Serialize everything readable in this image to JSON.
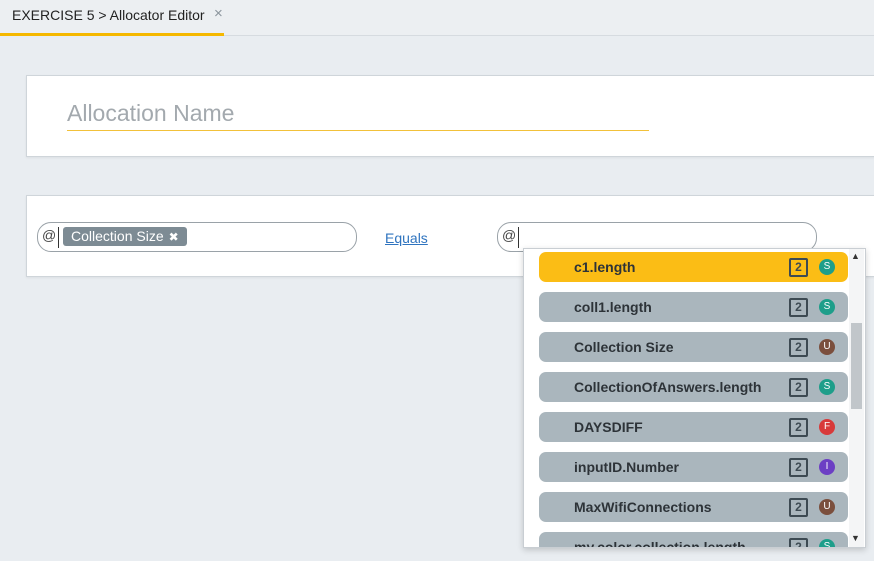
{
  "tab": {
    "title": "EXERCISE 5 > Allocator Editor",
    "close_icon": "×"
  },
  "allocation": {
    "name_value": "",
    "name_placeholder": "Allocation Name"
  },
  "rule": {
    "left_at": "@",
    "chip_label": "Collection Size",
    "chip_remove": "✖",
    "operator_label": "Equals",
    "right_at": "@"
  },
  "dropdown": {
    "scroll_up": "▲",
    "scroll_down": "▼",
    "items": [
      {
        "label": "c1.length",
        "type_icon": "2",
        "badge": "S",
        "badge_color": "#1e9e8a",
        "selected": true
      },
      {
        "label": "coll1.length",
        "type_icon": "2",
        "badge": "S",
        "badge_color": "#1e9e8a"
      },
      {
        "label": "Collection Size",
        "type_icon": "2",
        "badge": "U",
        "badge_color": "#7b4f3d"
      },
      {
        "label": "CollectionOfAnswers.length",
        "type_icon": "2",
        "badge": "S",
        "badge_color": "#1e9e8a"
      },
      {
        "label": "DAYSDIFF",
        "type_icon": "2",
        "badge": "F",
        "badge_color": "#d83a3a"
      },
      {
        "label": "inputID.Number",
        "type_icon": "2",
        "badge": "I",
        "badge_color": "#6c3fc4"
      },
      {
        "label": "MaxWifiConnections",
        "type_icon": "2",
        "badge": "U",
        "badge_color": "#7b4f3d"
      },
      {
        "label": "my.color.collection.length",
        "type_icon": "2",
        "badge": "S",
        "badge_color": "#1e9e8a"
      }
    ]
  }
}
